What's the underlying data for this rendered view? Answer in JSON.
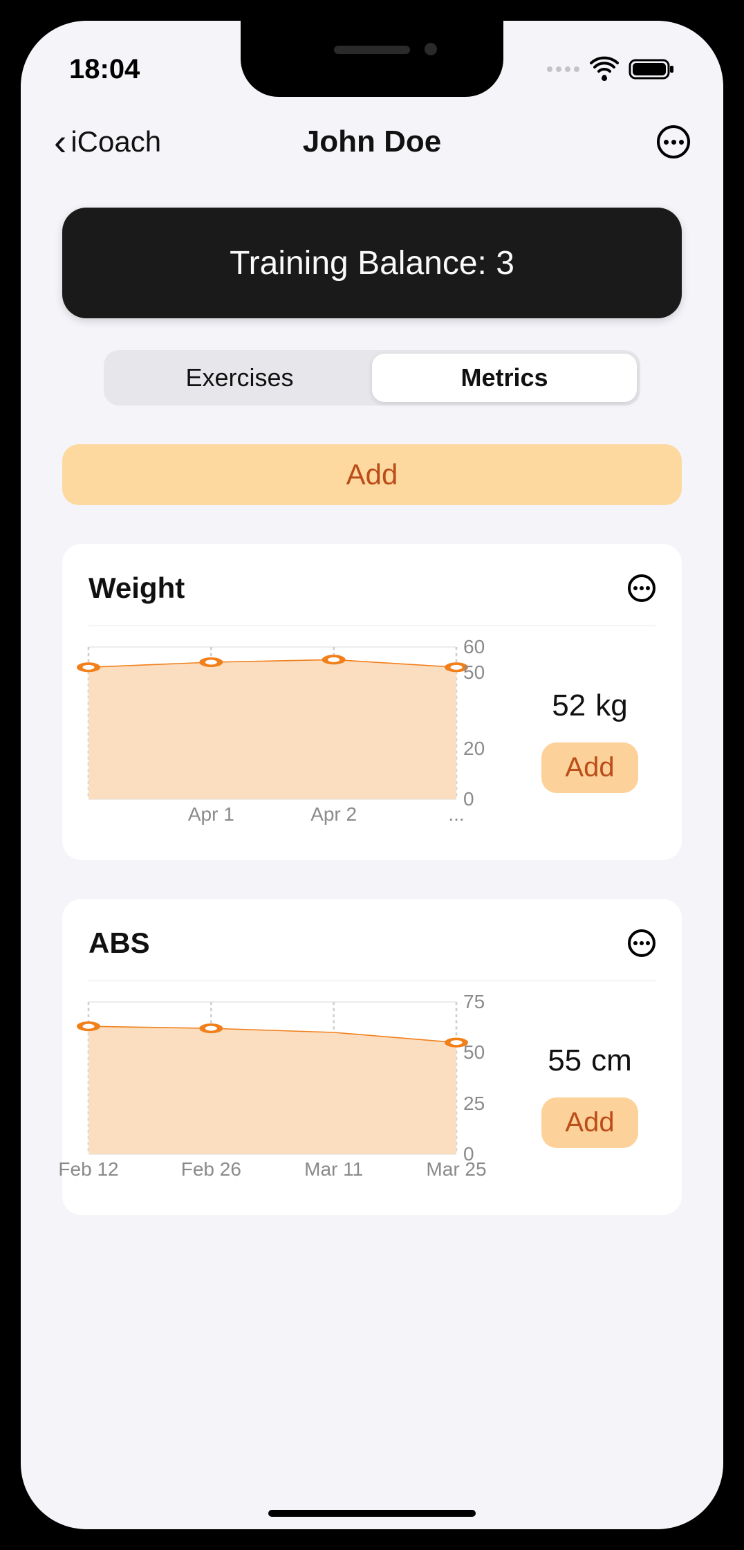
{
  "status": {
    "time": "18:04"
  },
  "nav": {
    "back_label": "iCoach",
    "title": "John Doe"
  },
  "banner": {
    "text": "Training Balance: 3"
  },
  "tabs": {
    "exercises": "Exercises",
    "metrics": "Metrics",
    "active": "metrics"
  },
  "add_button": "Add",
  "metrics": [
    {
      "title": "Weight",
      "value": "52",
      "unit": "kg",
      "add_label": "Add"
    },
    {
      "title": "ABS",
      "value": "55",
      "unit": "cm",
      "add_label": "Add"
    }
  ],
  "colors": {
    "line": "#f17f1a",
    "fill": "#fbdec0",
    "grid": "#d8d8d8",
    "gridDash": "#cfcfcf"
  },
  "chart_data": [
    {
      "type": "area",
      "title": "Weight",
      "ylabel": "",
      "xlabel": "",
      "ylim": [
        0,
        60
      ],
      "yticks": [
        0,
        20,
        50,
        60
      ],
      "x": [
        "",
        "Apr 1",
        "Apr 2",
        "..."
      ],
      "series": [
        {
          "name": "Weight",
          "values": [
            52,
            54,
            55,
            52
          ]
        }
      ],
      "annotations": []
    },
    {
      "type": "area",
      "title": "ABS",
      "ylabel": "",
      "xlabel": "",
      "ylim": [
        0,
        75
      ],
      "yticks": [
        0,
        25,
        50,
        75
      ],
      "x": [
        "Feb 12",
        "Feb 26",
        "Mar 11",
        "Mar 25"
      ],
      "xticks_labels": [
        "Feb 12",
        "Feb 26",
        "Mar 11",
        "Mar 25"
      ],
      "series": [
        {
          "name": "ABS",
          "values": [
            63,
            62,
            60,
            55
          ]
        }
      ],
      "annotations": [],
      "points_visible_index": [
        0,
        1,
        3
      ]
    }
  ]
}
